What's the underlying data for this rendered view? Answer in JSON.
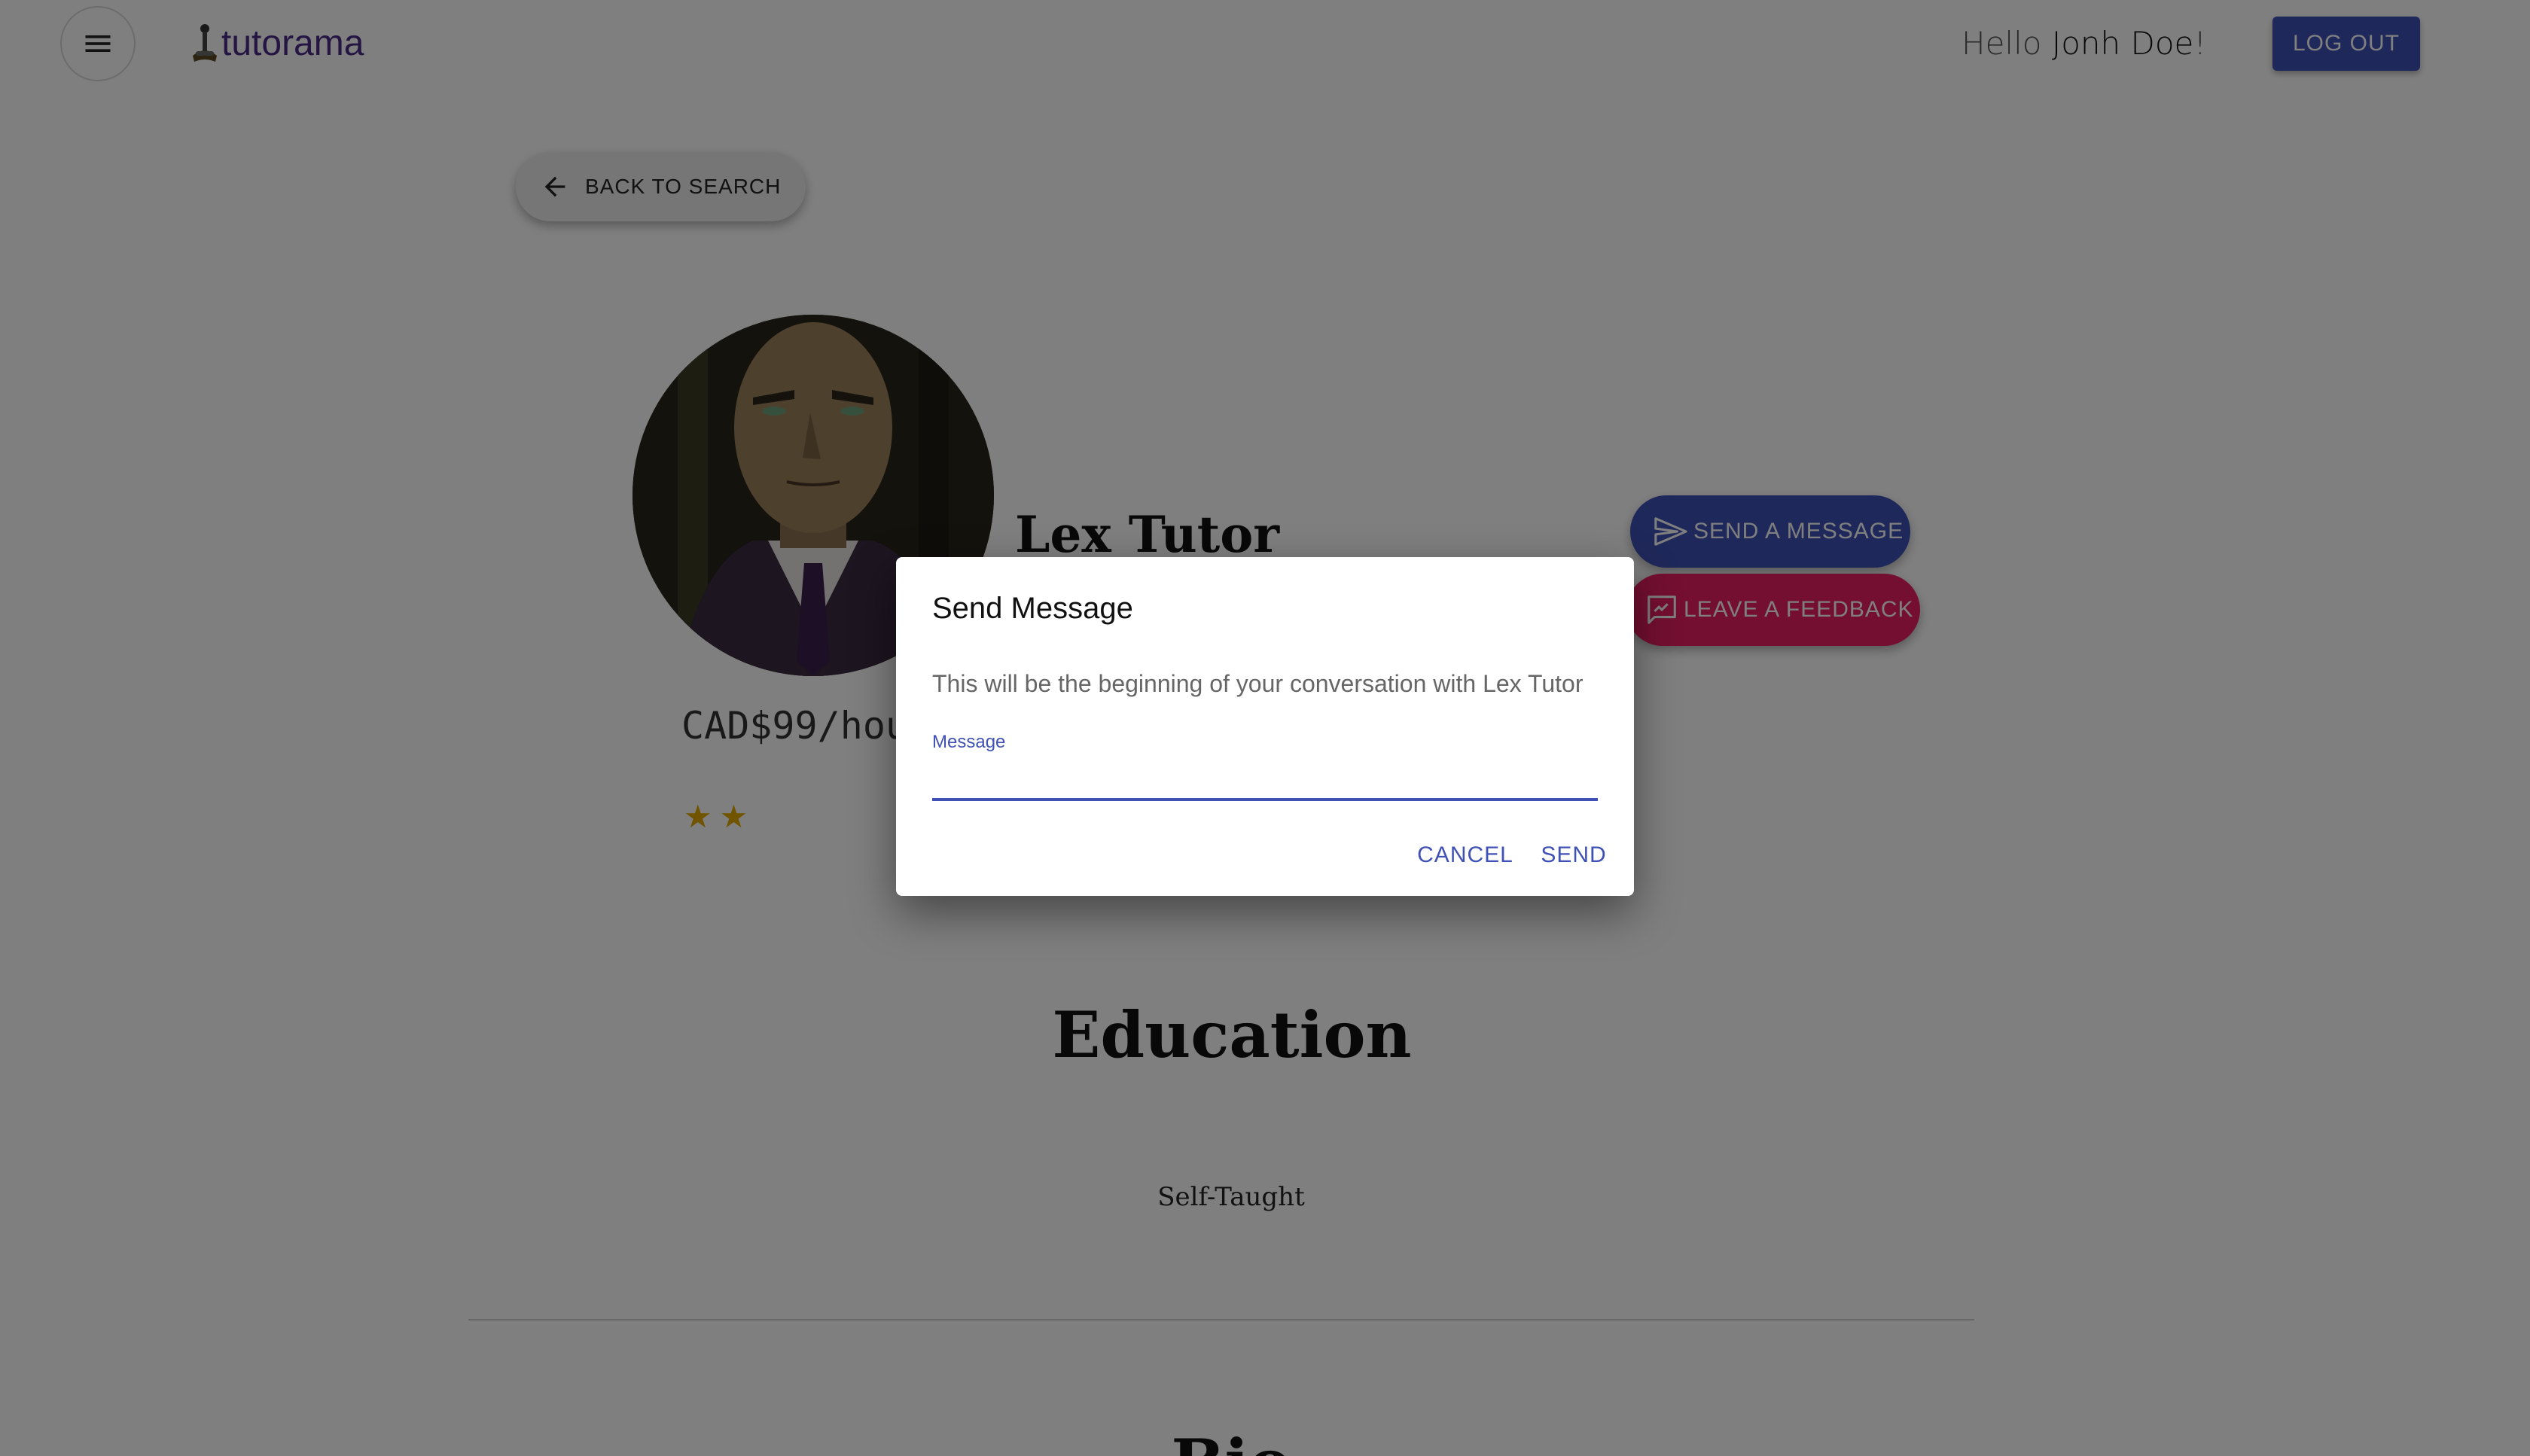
{
  "header": {
    "logo_text": "tutorama",
    "greeting_prefix": "Hello ",
    "user_name": "Jonh Doe",
    "greeting_suffix": "!",
    "logout_label": "LOG OUT"
  },
  "nav": {
    "back_label": "BACK TO SEARCH"
  },
  "profile": {
    "name": "Lex Tutor",
    "price": "CAD$99/hou",
    "rating_stars": 2,
    "stars_display": "★★",
    "send_message_label": "SEND A MESSAGE",
    "leave_feedback_label": "LEAVE A FEEDBACK"
  },
  "sections": {
    "education_heading": "Education",
    "education_value": "Self-Taught",
    "bio_heading": "Bio"
  },
  "dialog": {
    "title": "Send Message",
    "text": "This will be the beginning of your conversation with Lex Tutor",
    "field_label": "Message",
    "field_value": "",
    "cancel_label": "CANCEL",
    "send_label": "SEND"
  },
  "colors": {
    "primary": "#3f51b5",
    "secondary": "#e91e63",
    "star": "#e0a800",
    "brand": "#4b2a87"
  },
  "icons": {
    "menu": "hamburger-menu-icon",
    "back": "arrow-left-icon",
    "send": "send-icon",
    "feedback": "feedback-icon",
    "logo": "joystick-logo-icon"
  }
}
